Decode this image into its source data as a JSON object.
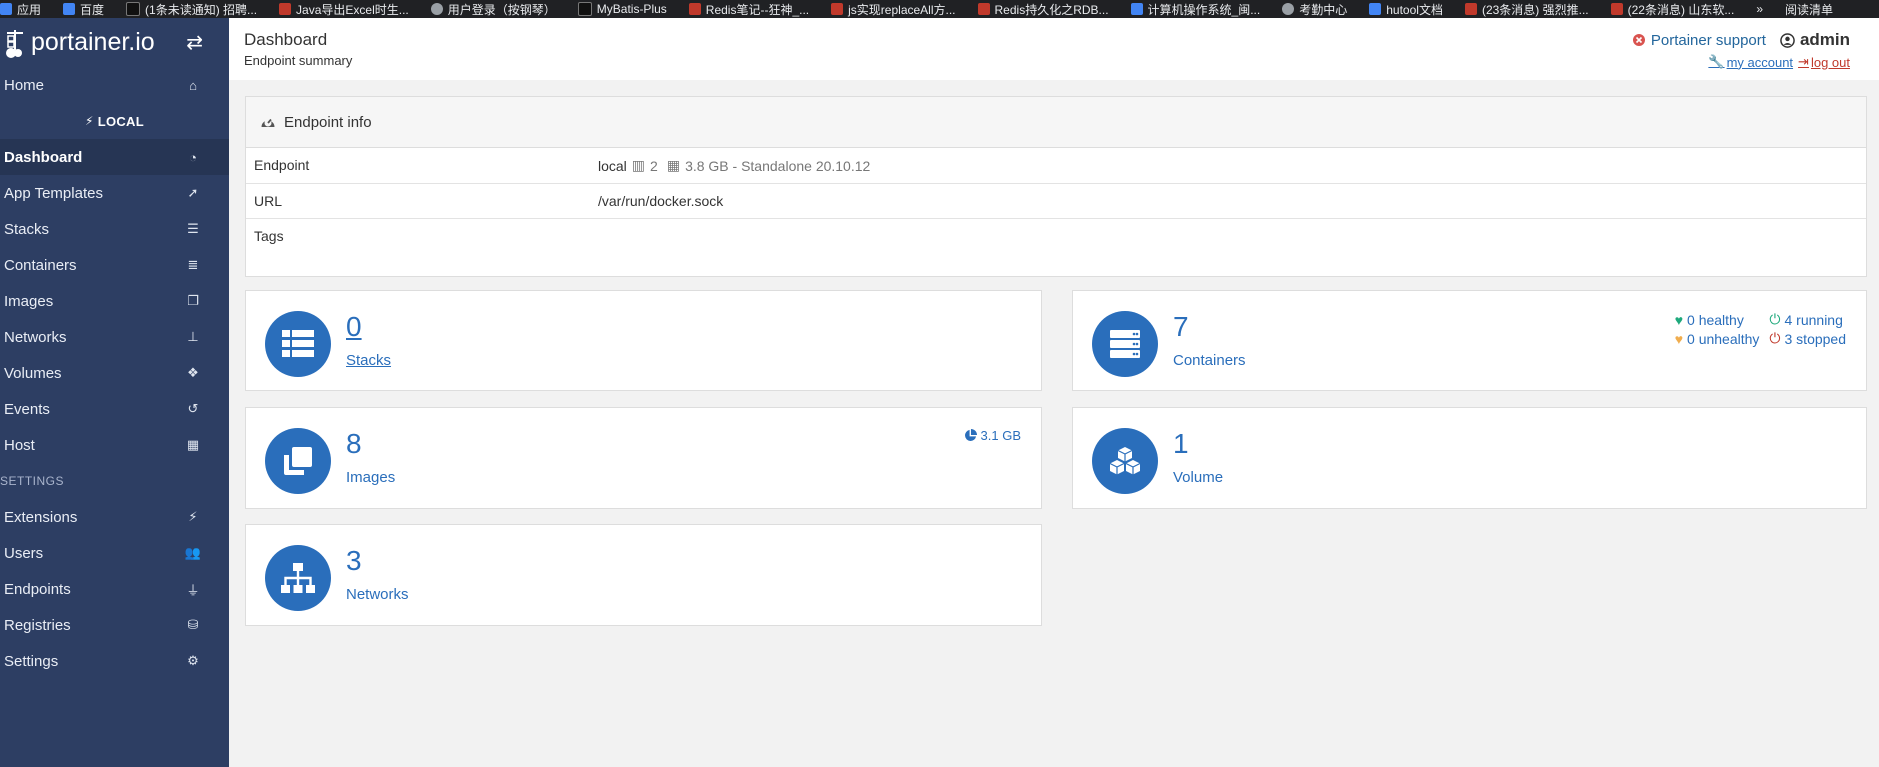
{
  "bookmarks": [
    {
      "label": "应用",
      "fav": "b"
    },
    {
      "label": "百度",
      "fav": "b"
    },
    {
      "label": "(1条未读通知) 招聘...",
      "fav": "k"
    },
    {
      "label": "Java导出Excel时生...",
      "fav": "c"
    },
    {
      "label": "用户登录（按钢琴）",
      "fav": "g"
    },
    {
      "label": "MyBatis-Plus",
      "fav": "k"
    },
    {
      "label": "Redis笔记--狂神_...",
      "fav": "c"
    },
    {
      "label": "js实现replaceAll方...",
      "fav": "c"
    },
    {
      "label": "Redis持久化之RDB...",
      "fav": "c"
    },
    {
      "label": "计算机操作系统_闽...",
      "fav": "b"
    },
    {
      "label": "考勤中心",
      "fav": "g"
    },
    {
      "label": "hutool文档",
      "fav": "b"
    },
    {
      "label": "(23条消息) 强烈推...",
      "fav": "c"
    },
    {
      "label": "(22条消息) 山东软...",
      "fav": "c"
    },
    {
      "label": "»",
      "fav": ""
    },
    {
      "label": "阅读清单",
      "fav": ""
    }
  ],
  "sidebar": {
    "logo_text": "portainer.io",
    "endpoint_name": "LOCAL",
    "settings_title": "SETTINGS",
    "items_top": [
      {
        "label": "Home",
        "icon": "home-icon"
      }
    ],
    "items_endpoint": [
      {
        "label": "Dashboard",
        "icon": "tachometer-icon",
        "active": true
      },
      {
        "label": "App Templates",
        "icon": "rocket-icon"
      },
      {
        "label": "Stacks",
        "icon": "th-list-icon"
      },
      {
        "label": "Containers",
        "icon": "server-icon"
      },
      {
        "label": "Images",
        "icon": "clone-icon"
      },
      {
        "label": "Networks",
        "icon": "sitemap-icon"
      },
      {
        "label": "Volumes",
        "icon": "cubes-icon"
      },
      {
        "label": "Events",
        "icon": "history-icon"
      },
      {
        "label": "Host",
        "icon": "th-icon"
      }
    ],
    "items_settings": [
      {
        "label": "Extensions",
        "icon": "bolt-icon"
      },
      {
        "label": "Users",
        "icon": "users-icon"
      },
      {
        "label": "Endpoints",
        "icon": "plug-icon"
      },
      {
        "label": "Registries",
        "icon": "database-icon"
      },
      {
        "label": "Settings",
        "icon": "cogs-icon"
      }
    ]
  },
  "header": {
    "title": "Dashboard",
    "subtitle": "Endpoint summary",
    "support_label": "Portainer support",
    "user": "admin",
    "my_account": "my account",
    "log_out": "log out"
  },
  "endpoint_info": {
    "title": "Endpoint info",
    "rows": {
      "endpoint_key": "Endpoint",
      "endpoint_name": "local",
      "cpu": "2",
      "memory": "3.8 GB - Standalone 20.10.12",
      "url_key": "URL",
      "url": "/var/run/docker.sock",
      "tags_key": "Tags"
    }
  },
  "widgets": {
    "stacks": {
      "count": "0",
      "label": "Stacks"
    },
    "containers": {
      "count": "7",
      "label": "Containers",
      "healthy": "0 healthy",
      "unhealthy": "0 unhealthy",
      "running": "4 running",
      "stopped": "3 stopped"
    },
    "images": {
      "count": "8",
      "label": "Images",
      "size": "3.1 GB"
    },
    "volumes": {
      "count": "1",
      "label": "Volume"
    },
    "networks": {
      "count": "3",
      "label": "Networks"
    }
  },
  "colors": {
    "sidebar_bg": "#2d3e63",
    "accent": "#2a6ebb",
    "healthy": "#1ea97c",
    "unhealthy": "#f0ad4e",
    "running": "#1ea97c",
    "stopped": "#c0392b"
  }
}
